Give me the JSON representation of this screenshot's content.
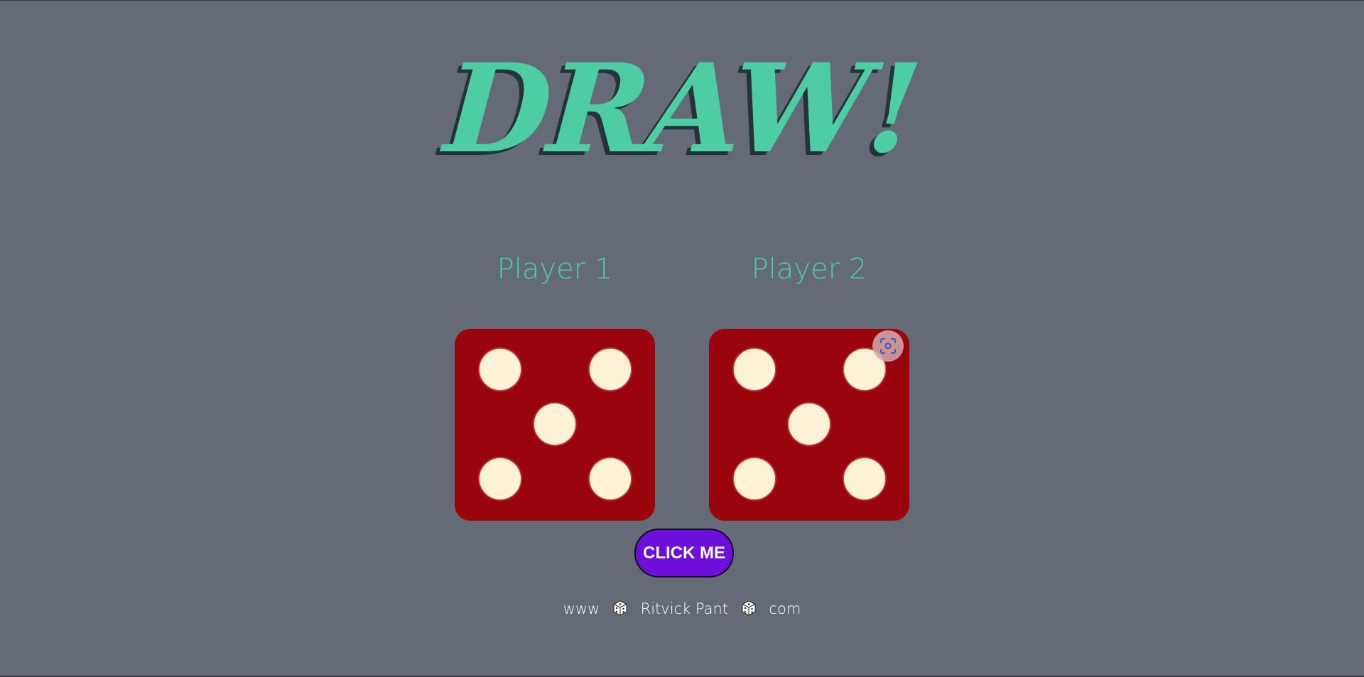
{
  "title": "DRAW!",
  "players": [
    {
      "label": "Player 1",
      "die_value": 5
    },
    {
      "label": "Player 2",
      "die_value": 5
    }
  ],
  "button": {
    "label": "CLICK ME"
  },
  "footer": {
    "prefix": "www",
    "name": "Ritvick Pant",
    "suffix": "com",
    "separator_icon": "dice-icon"
  },
  "colors": {
    "background": "#646b76",
    "accent": "#4ecca3",
    "die": "#9a050d",
    "pip": "#fdf1d8",
    "button": "#6c0fdb"
  }
}
